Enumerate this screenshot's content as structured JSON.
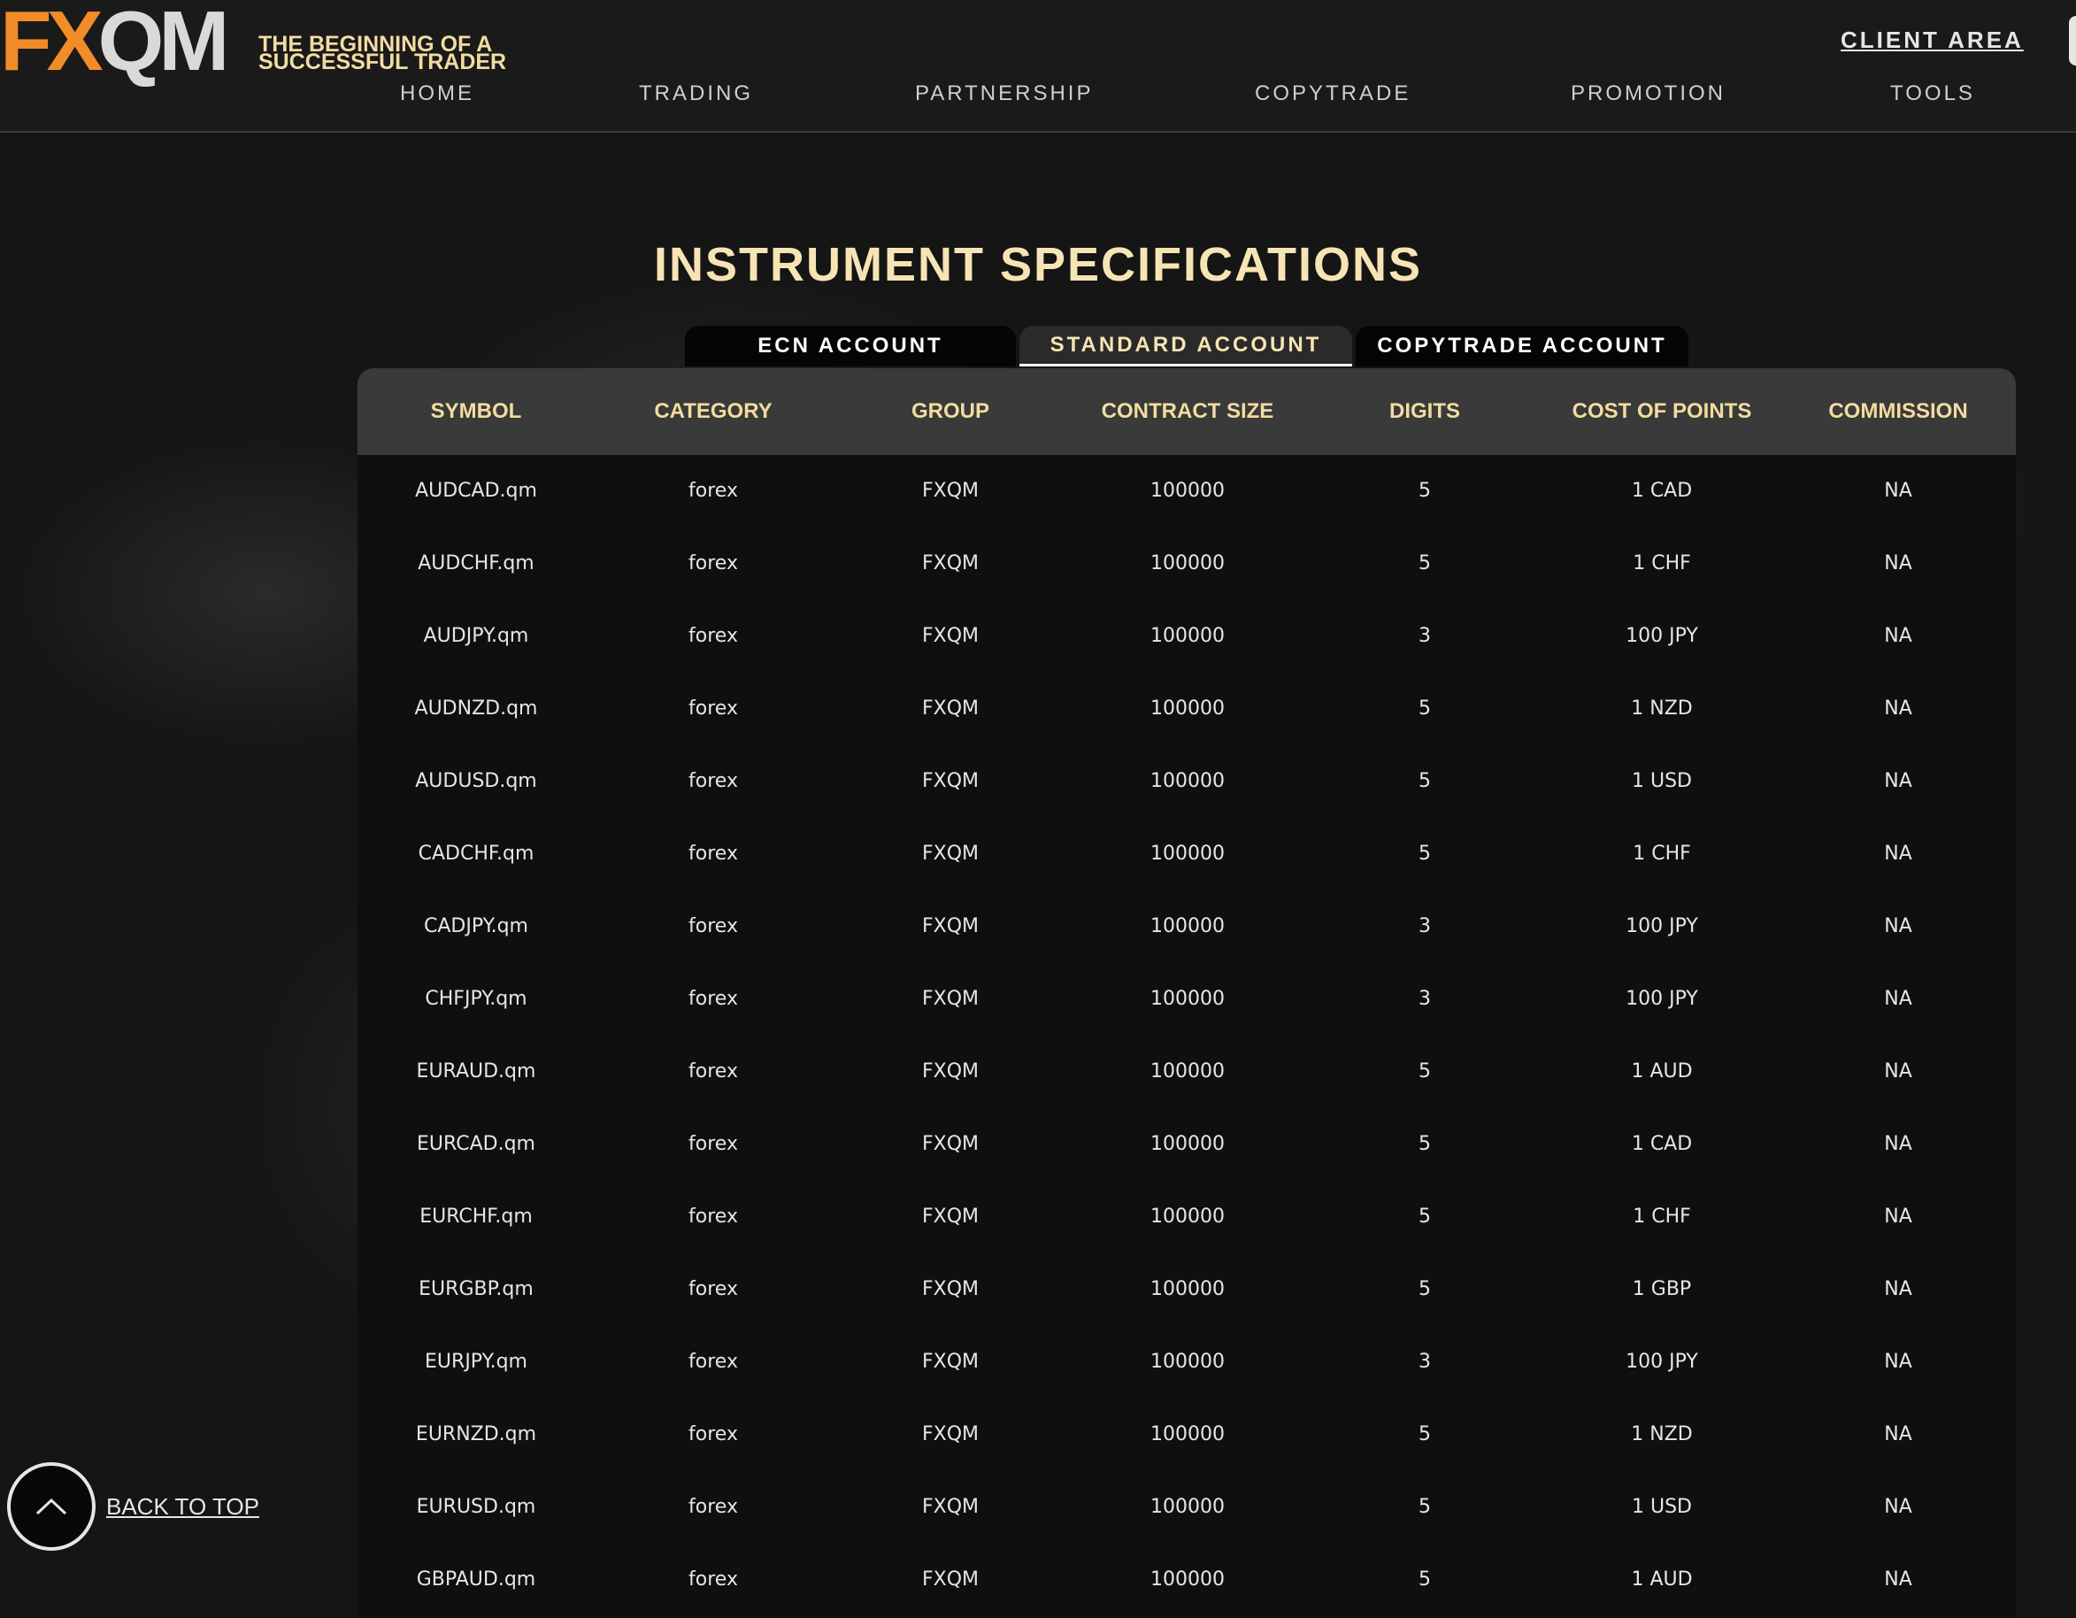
{
  "header": {
    "logo_fx": "FX",
    "logo_qm": "QM",
    "tagline_line1": "THE BEGINNING OF A",
    "tagline_line2": "SUCCESSFUL TRADER",
    "client_area": "CLIENT AREA",
    "nav": [
      "HOME",
      "TRADING",
      "PARTNERSHIP",
      "COPYTRADE",
      "PROMOTION",
      "TOOLS"
    ]
  },
  "main": {
    "title": "INSTRUMENT SPECIFICATIONS",
    "tabs": [
      "ECN ACCOUNT",
      "STANDARD ACCOUNT",
      "COPYTRADE ACCOUNT"
    ],
    "active_tab": "STANDARD ACCOUNT"
  },
  "table": {
    "columns": [
      "SYMBOL",
      "CATEGORY",
      "GROUP",
      "CONTRACT SIZE",
      "DIGITS",
      "COST OF POINTS",
      "COMMISSION"
    ],
    "rows": [
      [
        "AUDCAD.qm",
        "forex",
        "FXQM",
        "100000",
        "5",
        "1 CAD",
        "NA"
      ],
      [
        "AUDCHF.qm",
        "forex",
        "FXQM",
        "100000",
        "5",
        "1 CHF",
        "NA"
      ],
      [
        "AUDJPY.qm",
        "forex",
        "FXQM",
        "100000",
        "3",
        "100 JPY",
        "NA"
      ],
      [
        "AUDNZD.qm",
        "forex",
        "FXQM",
        "100000",
        "5",
        "1 NZD",
        "NA"
      ],
      [
        "AUDUSD.qm",
        "forex",
        "FXQM",
        "100000",
        "5",
        "1 USD",
        "NA"
      ],
      [
        "CADCHF.qm",
        "forex",
        "FXQM",
        "100000",
        "5",
        "1 CHF",
        "NA"
      ],
      [
        "CADJPY.qm",
        "forex",
        "FXQM",
        "100000",
        "3",
        "100 JPY",
        "NA"
      ],
      [
        "CHFJPY.qm",
        "forex",
        "FXQM",
        "100000",
        "3",
        "100 JPY",
        "NA"
      ],
      [
        "EURAUD.qm",
        "forex",
        "FXQM",
        "100000",
        "5",
        "1 AUD",
        "NA"
      ],
      [
        "EURCAD.qm",
        "forex",
        "FXQM",
        "100000",
        "5",
        "1 CAD",
        "NA"
      ],
      [
        "EURCHF.qm",
        "forex",
        "FXQM",
        "100000",
        "5",
        "1 CHF",
        "NA"
      ],
      [
        "EURGBP.qm",
        "forex",
        "FXQM",
        "100000",
        "5",
        "1 GBP",
        "NA"
      ],
      [
        "EURJPY.qm",
        "forex",
        "FXQM",
        "100000",
        "3",
        "100 JPY",
        "NA"
      ],
      [
        "EURNZD.qm",
        "forex",
        "FXQM",
        "100000",
        "5",
        "1 NZD",
        "NA"
      ],
      [
        "EURUSD.qm",
        "forex",
        "FXQM",
        "100000",
        "5",
        "1 USD",
        "NA"
      ],
      [
        "GBPAUD.qm",
        "forex",
        "FXQM",
        "100000",
        "5",
        "1 AUD",
        "NA"
      ]
    ]
  },
  "back_to_top": {
    "label": "BACK TO TOP",
    "icon": "chevron-up-icon"
  },
  "colors": {
    "accent_orange": "#f28c28",
    "accent_cream": "#f3dca0",
    "background": "#151515",
    "header_row": "#3a3a3a"
  }
}
